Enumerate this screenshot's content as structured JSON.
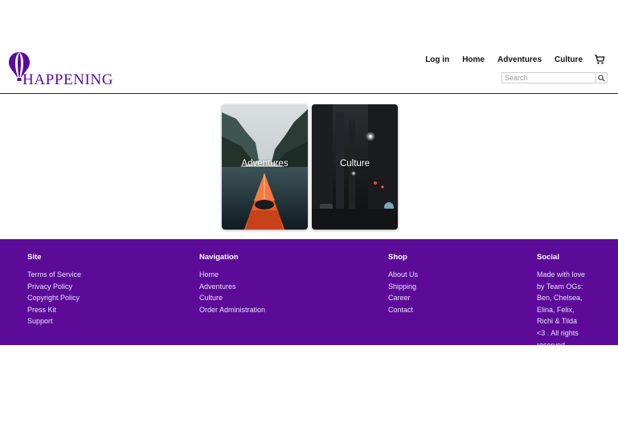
{
  "brand": {
    "name": "HAPPENING",
    "color": "#5a0a9e"
  },
  "header": {
    "nav": [
      {
        "label": "Log in"
      },
      {
        "label": "Home"
      },
      {
        "label": "Adventures"
      },
      {
        "label": "Culture"
      }
    ],
    "cart_icon": "cart-icon",
    "search": {
      "placeholder": "Search",
      "icon": "magnifier-icon"
    }
  },
  "cards": [
    {
      "label": "Adventures",
      "image": "kayak-fjord-photo"
    },
    {
      "label": "Culture",
      "image": "city-night-street-photo"
    }
  ],
  "footer": {
    "background": "#5c0b99",
    "site": {
      "heading": "Site",
      "links": [
        "Terms of Service",
        "Privacy Policy",
        "Copyright Policy",
        "Press Kit",
        "Support"
      ]
    },
    "navigation": {
      "heading": "Navigation",
      "links": [
        "Home",
        "Adventures",
        "Culture",
        "Order Administration"
      ]
    },
    "shop": {
      "heading": "Shop",
      "links": [
        "About Us",
        "Shipping",
        "Career",
        "Contact"
      ]
    },
    "social": {
      "heading": "Social",
      "lines": [
        "Made with love",
        "by Team OGs:",
        "Ben, Chelsea,",
        "Elina, Felix,",
        "Richi & Tilda",
        "<3 . All rights",
        "reserved"
      ]
    }
  }
}
